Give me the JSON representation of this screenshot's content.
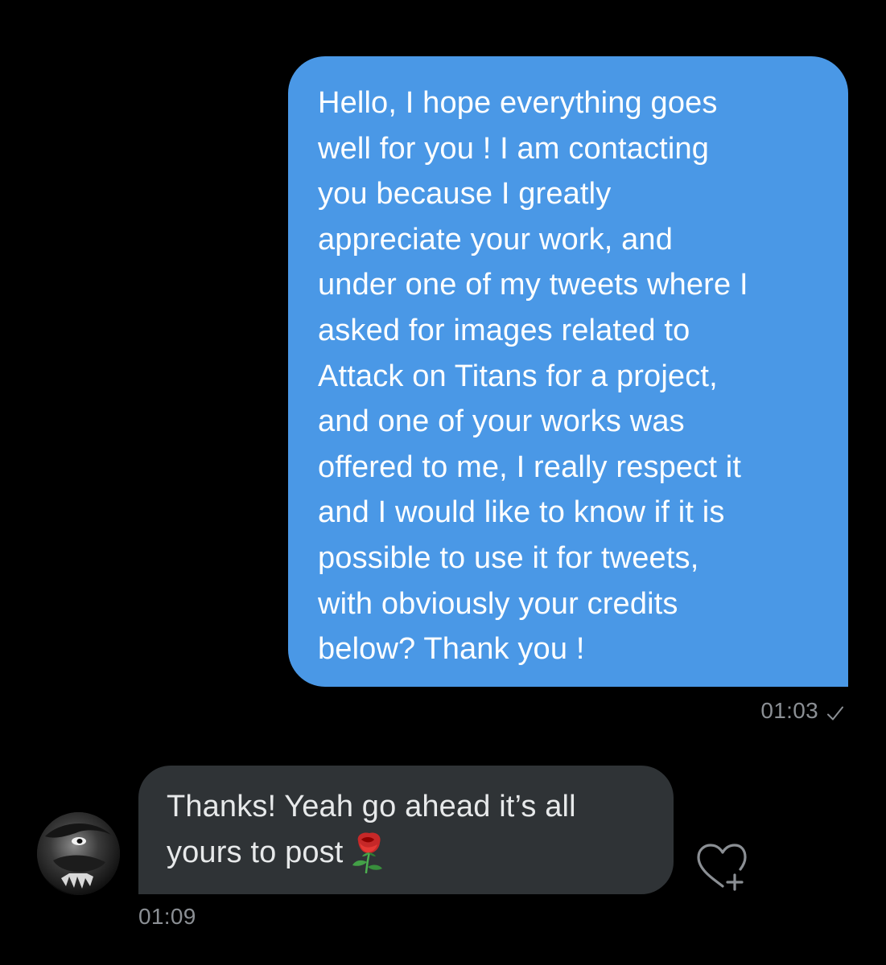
{
  "conversation": {
    "sent_message": {
      "lines": [
        "Hello, I hope everything goes",
        "well for you ! I am contacting",
        "you because I greatly",
        "appreciate your work, and",
        "under one of my tweets where I",
        "asked for images related to",
        "Attack on Titans for a project,",
        "and one of your works was",
        "offered to me, I really respect it",
        "and I would like to know if it is",
        "possible to use it for tweets,",
        "with obviously your credits",
        "below? Thank you !"
      ],
      "timestamp": "01:03",
      "status_icon": "sent-check-icon",
      "bubble_color": "#4a98e6"
    },
    "received_message": {
      "lines": [
        "Thanks! Yeah go ahead it’s all",
        "yours to post"
      ],
      "emoji": "rose-emoji",
      "timestamp": "01:09",
      "bubble_color": "#2f3336",
      "avatar_icon": "avatar",
      "reaction_icon": "add-reaction-heart-icon"
    }
  },
  "colors": {
    "background": "#000000",
    "meta_text": "#8b8f94",
    "sent_text": "#ffffff",
    "received_text": "#e7e9ea"
  }
}
